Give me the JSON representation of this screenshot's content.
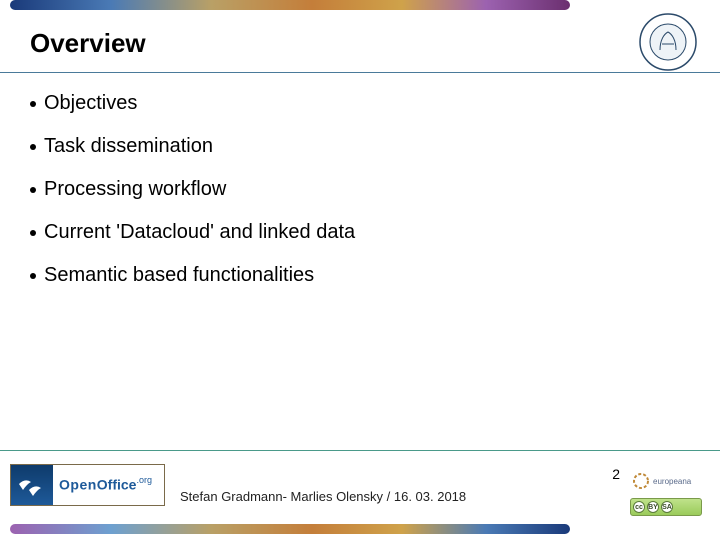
{
  "header": {
    "title": "Overview",
    "logo_name": "humboldt-seal-icon"
  },
  "bullets": [
    "Objectives",
    "Task dissemination",
    "Processing workflow",
    "Current 'Datacloud' and linked data",
    "Semantic based functionalities"
  ],
  "footer": {
    "openoffice": {
      "open": "Open",
      "office": "Office",
      "org": ".org"
    },
    "attribution": "Stefan Gradmann- Marlies Olensky / 16. 03. 2018",
    "page_number": "2",
    "europeana_label": "europeana",
    "cc": {
      "cc": "cc",
      "by": "BY",
      "sa": "SA"
    }
  }
}
